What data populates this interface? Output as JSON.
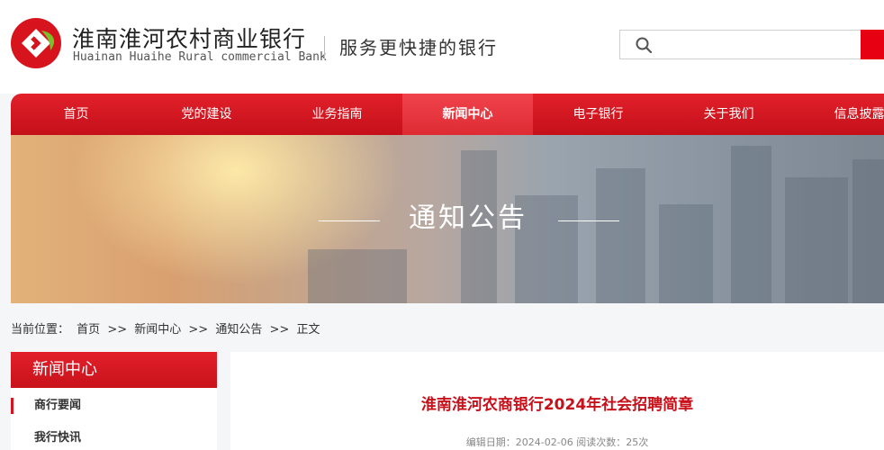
{
  "header": {
    "bank_name_cn": "淮南淮河农村商业银行",
    "bank_name_en": "Huainan Huaihe Rural commercial Bank",
    "slogan": "服务更快捷的银行",
    "search_placeholder": ""
  },
  "colors": {
    "brand_red": "#d7141e",
    "logo_green": "#7bbf2a"
  },
  "nav": {
    "items": [
      {
        "label": "首页"
      },
      {
        "label": "党的建设"
      },
      {
        "label": "业务指南"
      },
      {
        "label": "新闻中心"
      },
      {
        "label": "电子银行"
      },
      {
        "label": "关于我们"
      },
      {
        "label": "信息披露"
      }
    ],
    "active_index": 3
  },
  "banner": {
    "title": "通知公告"
  },
  "breadcrumb": {
    "prefix": "当前位置：",
    "items": [
      "首页",
      "新闻中心",
      "通知公告",
      "正文"
    ],
    "separator": ">>"
  },
  "sidebar": {
    "title": "新闻中心",
    "items": [
      {
        "label": "商行要闻"
      },
      {
        "label": "我行快讯"
      }
    ]
  },
  "article": {
    "title": "淮南淮河农商银行2024年社会招聘简章",
    "meta": "编辑日期：2024-02-06  阅读次数：25次"
  }
}
